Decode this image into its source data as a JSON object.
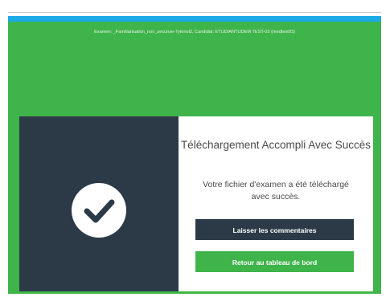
{
  "header": {
    "exam_info": "Examen: _Familiarisation_non_securise-Tylenol2, Candidat: ETUDIANTUDEM TEST-03 (medtest03)"
  },
  "dialog": {
    "title": "Téléchargement Accompli Avec Succès",
    "message": "Votre fichier d'examen a été téléchargé avec succès.",
    "comments_button": "Laisser les commentaires",
    "dashboard_button": "Retour au tableau de bord",
    "icon": "checkmark-icon"
  },
  "colors": {
    "accent_green": "#3fb44a",
    "top_bar_blue": "#1ca9e6",
    "dark_panel": "#2c3a47"
  }
}
